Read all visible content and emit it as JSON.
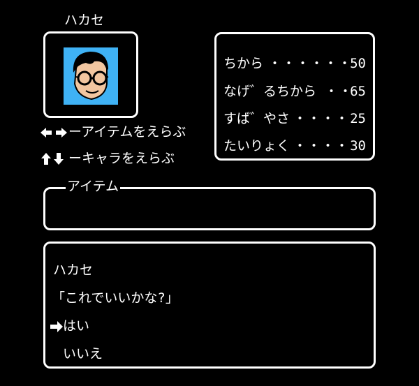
{
  "character": {
    "name": "ハカセ",
    "portrait": "scientist-face-with-glasses"
  },
  "stats": [
    {
      "label": "ちから",
      "dots": "・・・・・・",
      "value": "50"
    },
    {
      "label": "なげ゛るちから",
      "dots": "・・",
      "value": "65"
    },
    {
      "label": "すば゛やさ",
      "dots": "・・・・",
      "value": "25"
    },
    {
      "label": "たいりょく",
      "dots": "・・・・",
      "value": "30"
    }
  ],
  "controls": {
    "item_select": {
      "icon": "left-right-arrows",
      "text": "ーアイテムをえらぶ"
    },
    "char_select": {
      "icon": "up-down-arrows",
      "text": "ーキャラをえらぶ"
    }
  },
  "item_box": {
    "legend": "アイテム"
  },
  "dialog": {
    "speaker": "ハカセ",
    "message": "「これでいいかな?」",
    "cursor": "right-arrow",
    "options": [
      "はい",
      "いいえ"
    ],
    "selected_index": 0
  },
  "colors": {
    "background": "#000000",
    "text": "#ffffff",
    "portrait_bg": "#3fb2f5"
  }
}
